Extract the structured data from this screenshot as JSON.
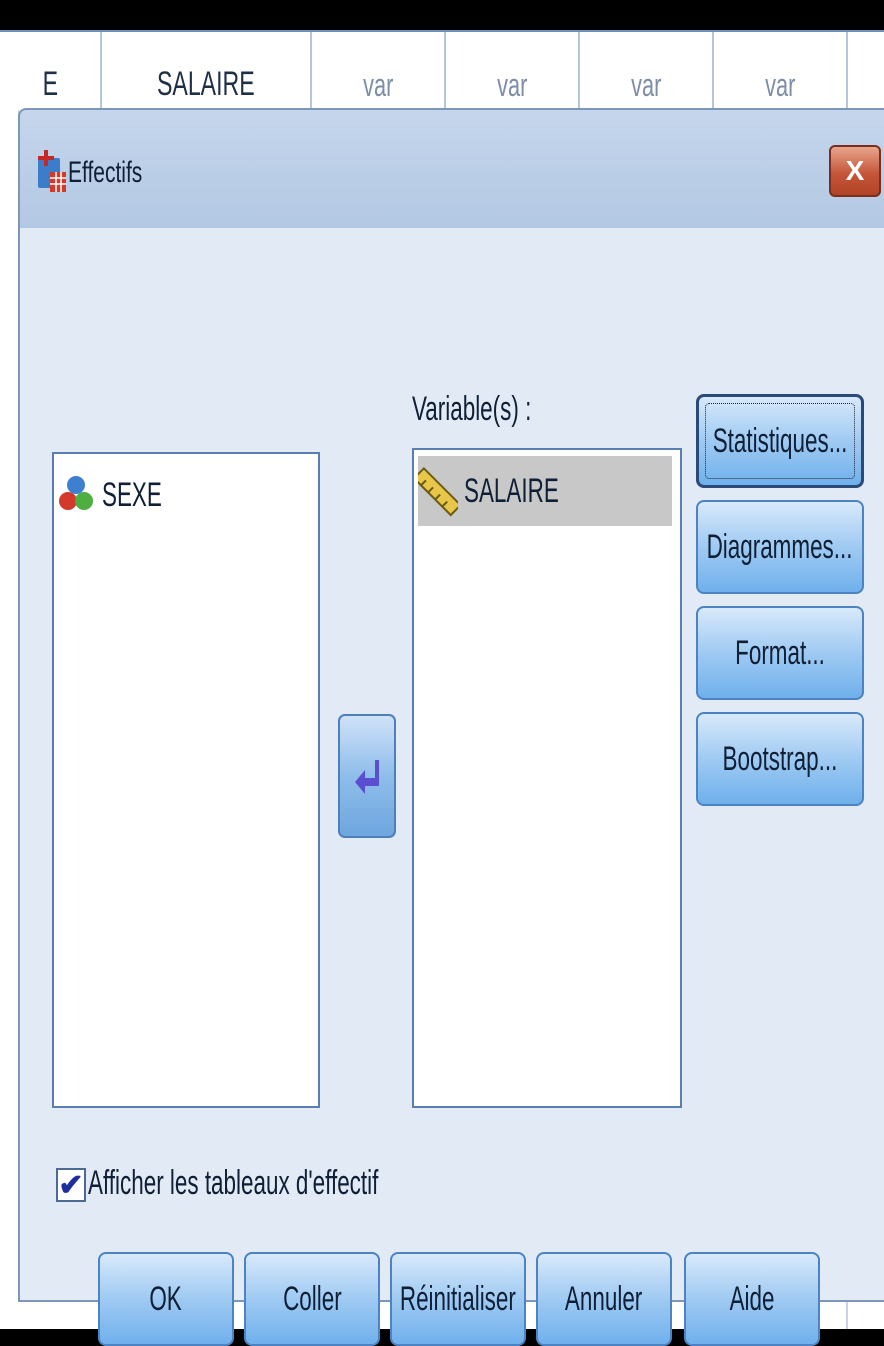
{
  "sheet": {
    "columns": [
      "E",
      "SALAIRE",
      "var",
      "var",
      "var",
      "var"
    ]
  },
  "dialog": {
    "title": "Effectifs",
    "close_label": "X",
    "source_list": {
      "items": [
        {
          "label": "SEXE",
          "icon": "nominal-variable-icon"
        }
      ]
    },
    "variables_label": "Variable(s) :",
    "target_list": {
      "items": [
        {
          "label": "SALAIRE",
          "icon": "scale-variable-icon"
        }
      ]
    },
    "side_buttons": {
      "statistiques": "Statistiques...",
      "diagrammes": "Diagrammes...",
      "format": "Format...",
      "bootstrap": "Bootstrap..."
    },
    "checkbox": {
      "label": "Afficher les tableaux d'effectif",
      "checked": true
    },
    "bottom_buttons": {
      "ok": "OK",
      "coller": "Coller",
      "reinitialiser": "Réinitialiser",
      "annuler": "Annuler",
      "aide": "Aide"
    }
  }
}
